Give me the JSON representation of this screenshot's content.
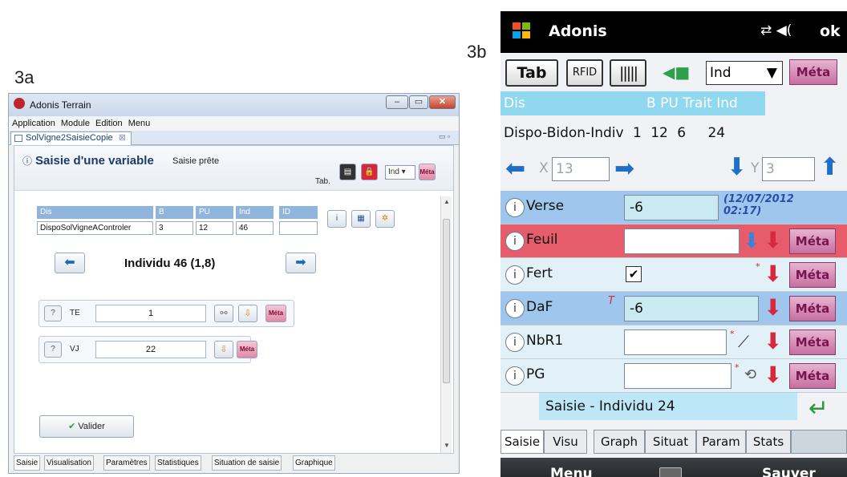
{
  "labels": {
    "fig_a": "3a",
    "fig_b": "3b"
  },
  "desktop": {
    "title": "Adonis Terrain",
    "menu": [
      "Application",
      "Module",
      "Edition",
      "Menu"
    ],
    "doc_tab": "SolVigne2SaisieCopie",
    "header": {
      "title": "Saisie d'une variable",
      "status": "Saisie prête",
      "tab_label": "Tab.",
      "ind_select": "Ind",
      "meta_label": "Méta"
    },
    "grid": {
      "headers": [
        "Dis",
        "B",
        "PU",
        "Ind",
        "ID"
      ],
      "values": [
        "DispoSolVigneAControler",
        "3",
        "12",
        "46",
        ""
      ]
    },
    "individu": "Individu  46 (1,8)",
    "variables": [
      {
        "name": "TE",
        "value": "1"
      },
      {
        "name": "VJ",
        "value": "22"
      }
    ],
    "validate_label": "Valider",
    "bottom_tabs": [
      "Saisie",
      "Visualisation",
      "Paramètres",
      "Statistiques",
      "Situation de saisie",
      "Graphique"
    ]
  },
  "mobile": {
    "app_title": "Adonis",
    "ok_label": "ok",
    "tab_button": "Tab",
    "ind_select": "Ind",
    "meta_label": "Méta",
    "header": {
      "dis": "Dis",
      "cols": "B PU Trait Ind"
    },
    "data_row": {
      "dis": "Dispo-Bidon-Indiv",
      "b": "1",
      "pu": "12",
      "trait": "6",
      "ind": "24"
    },
    "nav": {
      "x_label": "X",
      "x_value": "13",
      "y_label": "Y",
      "y_value": "3"
    },
    "variables": [
      {
        "name": "Verse",
        "value": "-6",
        "note": "(12/07/2012 02:17)"
      },
      {
        "name": "Feuil",
        "value": ""
      },
      {
        "name": "Fert",
        "value": "✔"
      },
      {
        "name": "DaF",
        "value": "-6",
        "mark": "T"
      },
      {
        "name": "NbR1",
        "value": ""
      },
      {
        "name": "PG",
        "value": ""
      }
    ],
    "saisie": "Saisie - Individu 24",
    "tabs": [
      "Saisie",
      "Visu",
      "Graph",
      "Situat",
      "Param",
      "Stats"
    ],
    "soft_left": "Menu",
    "soft_right": "Sauver"
  }
}
